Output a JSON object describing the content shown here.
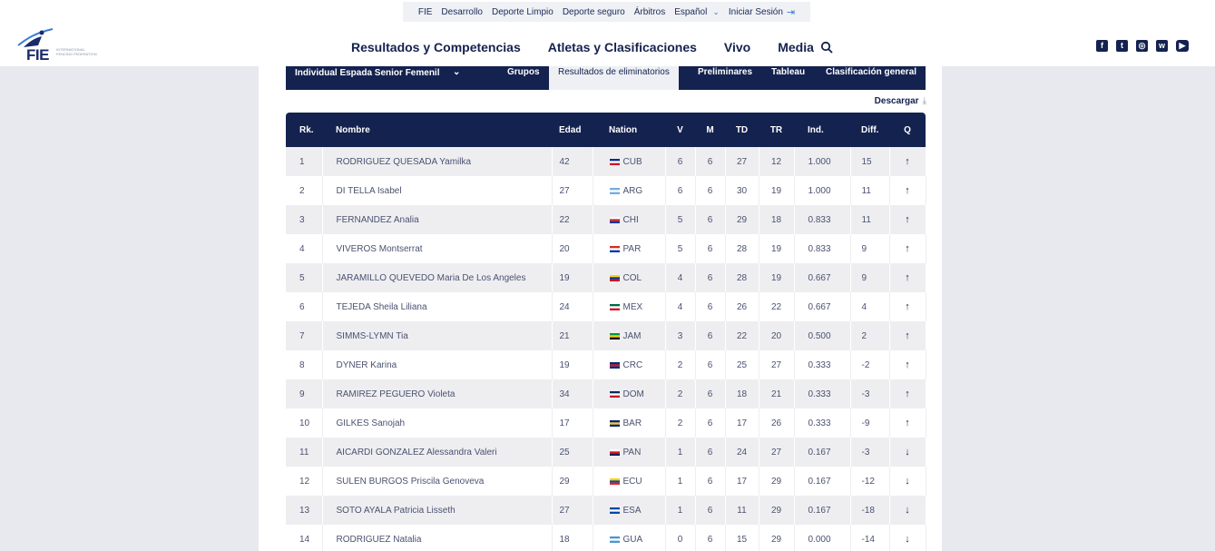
{
  "topbar": {
    "links": [
      "FIE",
      "Desarrollo",
      "Deporte Limpio",
      "Deporte seguro",
      "Árbitros",
      "Español",
      "Iniciar Sesión"
    ]
  },
  "logo": {
    "text": "FIE",
    "subtext": "INTERNATIONAL FENCING FEDERATION"
  },
  "nav": {
    "items": [
      "Resultados y Competencias",
      "Atletas y Clasificaciones",
      "Vivo",
      "Media"
    ]
  },
  "social": [
    "f",
    "t",
    "◎",
    "w",
    "▶"
  ],
  "tabs": {
    "selector_label": "Individual Espada Senior Femenil",
    "items": [
      "Grupos",
      "Resultados de eliminatorios",
      "Preliminares",
      "Tableau",
      "Clasificación general"
    ],
    "active_index": 1
  },
  "download_label": "Descargar",
  "table": {
    "headers": [
      "Rk.",
      "Nombre",
      "Edad",
      "Nation",
      "V",
      "M",
      "TD",
      "TR",
      "Ind.",
      "Diff.",
      "Q"
    ],
    "rows": [
      {
        "rk": "1",
        "name": "RODRIGUEZ QUESADA Yamilka",
        "edad": "42",
        "nation": "CUB",
        "v": "6",
        "m": "6",
        "td": "27",
        "tr": "12",
        "ind": "1.000",
        "diff": "15",
        "q": "up"
      },
      {
        "rk": "2",
        "name": "DI TELLA Isabel",
        "edad": "27",
        "nation": "ARG",
        "v": "6",
        "m": "6",
        "td": "30",
        "tr": "19",
        "ind": "1.000",
        "diff": "11",
        "q": "up"
      },
      {
        "rk": "3",
        "name": "FERNANDEZ Analia",
        "edad": "22",
        "nation": "CHI",
        "v": "5",
        "m": "6",
        "td": "29",
        "tr": "18",
        "ind": "0.833",
        "diff": "11",
        "q": "up"
      },
      {
        "rk": "4",
        "name": "VIVEROS Montserrat",
        "edad": "20",
        "nation": "PAR",
        "v": "5",
        "m": "6",
        "td": "28",
        "tr": "19",
        "ind": "0.833",
        "diff": "9",
        "q": "up"
      },
      {
        "rk": "5",
        "name": "JARAMILLO QUEVEDO Maria De Los Angeles",
        "edad": "19",
        "nation": "COL",
        "v": "4",
        "m": "6",
        "td": "28",
        "tr": "19",
        "ind": "0.667",
        "diff": "9",
        "q": "up"
      },
      {
        "rk": "6",
        "name": "TEJEDA Sheila Liliana",
        "edad": "24",
        "nation": "MEX",
        "v": "4",
        "m": "6",
        "td": "26",
        "tr": "22",
        "ind": "0.667",
        "diff": "4",
        "q": "up"
      },
      {
        "rk": "7",
        "name": "SIMMS-LYMN Tia",
        "edad": "21",
        "nation": "JAM",
        "v": "3",
        "m": "6",
        "td": "22",
        "tr": "20",
        "ind": "0.500",
        "diff": "2",
        "q": "up"
      },
      {
        "rk": "8",
        "name": "DYNER Karina",
        "edad": "19",
        "nation": "CRC",
        "v": "2",
        "m": "6",
        "td": "25",
        "tr": "27",
        "ind": "0.333",
        "diff": "-2",
        "q": "up"
      },
      {
        "rk": "9",
        "name": "RAMIREZ PEGUERO Violeta",
        "edad": "34",
        "nation": "DOM",
        "v": "2",
        "m": "6",
        "td": "18",
        "tr": "21",
        "ind": "0.333",
        "diff": "-3",
        "q": "up"
      },
      {
        "rk": "10",
        "name": "GILKES Sanojah",
        "edad": "17",
        "nation": "BAR",
        "v": "2",
        "m": "6",
        "td": "17",
        "tr": "26",
        "ind": "0.333",
        "diff": "-9",
        "q": "up"
      },
      {
        "rk": "11",
        "name": "AICARDI GONZALEZ Alessandra Valeri",
        "edad": "25",
        "nation": "PAN",
        "v": "1",
        "m": "6",
        "td": "24",
        "tr": "27",
        "ind": "0.167",
        "diff": "-3",
        "q": "down"
      },
      {
        "rk": "12",
        "name": "SULEN BURGOS Priscila Genoveva",
        "edad": "29",
        "nation": "ECU",
        "v": "1",
        "m": "6",
        "td": "17",
        "tr": "29",
        "ind": "0.167",
        "diff": "-12",
        "q": "down"
      },
      {
        "rk": "13",
        "name": "SOTO AYALA Patricia Lisseth",
        "edad": "27",
        "nation": "ESA",
        "v": "1",
        "m": "6",
        "td": "11",
        "tr": "29",
        "ind": "0.167",
        "diff": "-18",
        "q": "down"
      },
      {
        "rk": "14",
        "name": "RODRIGUEZ Natalia",
        "edad": "18",
        "nation": "GUA",
        "v": "0",
        "m": "6",
        "td": "15",
        "tr": "29",
        "ind": "0.000",
        "diff": "-14",
        "q": "down"
      }
    ]
  },
  "colors": {
    "navy": "#14224f",
    "accent_blue": "#3a7bd5",
    "row_alt": "#eeeef1",
    "page_bg": "#e8e9ef"
  },
  "flags": {
    "CUB": [
      "#002a8f",
      "#ffffff",
      "#cf142b"
    ],
    "ARG": [
      "#74acdf",
      "#ffffff",
      "#74acdf"
    ],
    "CHI": [
      "#ffffff",
      "#d52b1e",
      "#0039a6"
    ],
    "PAR": [
      "#d52b1e",
      "#ffffff",
      "#0038a8"
    ],
    "COL": [
      "#fcd116",
      "#003893",
      "#ce1126"
    ],
    "MEX": [
      "#006847",
      "#ffffff",
      "#ce1126"
    ],
    "JAM": [
      "#009b3a",
      "#fed100",
      "#000000"
    ],
    "CRC": [
      "#002b7f",
      "#ce1126",
      "#002b7f"
    ],
    "DOM": [
      "#002d62",
      "#ffffff",
      "#ce1126"
    ],
    "BAR": [
      "#00267f",
      "#ffc726",
      "#00267f"
    ],
    "PAN": [
      "#ffffff",
      "#da121a",
      "#072357"
    ],
    "ECU": [
      "#ffd100",
      "#034ea2",
      "#ed1c24"
    ],
    "ESA": [
      "#0047ab",
      "#ffffff",
      "#0047ab"
    ],
    "GUA": [
      "#4997d0",
      "#ffffff",
      "#4997d0"
    ]
  }
}
